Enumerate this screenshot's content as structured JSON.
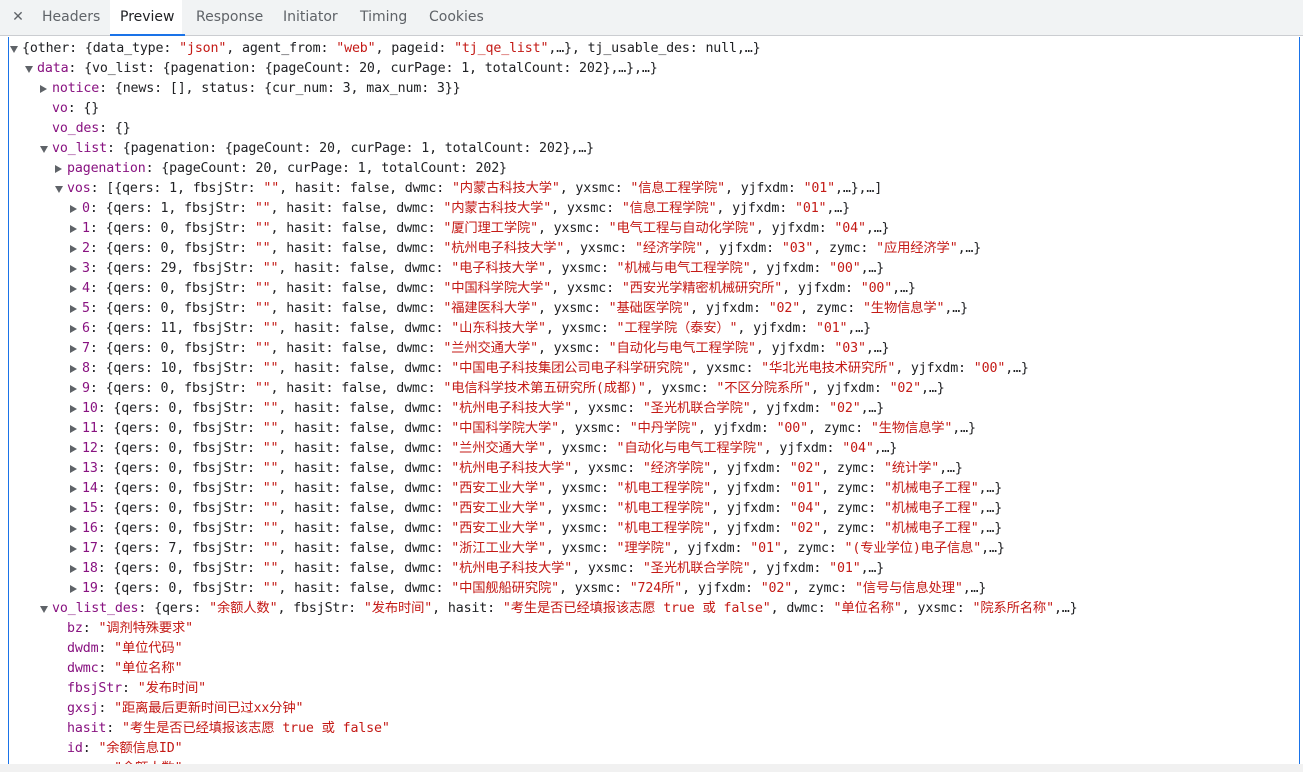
{
  "tabs": [
    {
      "label": "Headers"
    },
    {
      "label": "Preview"
    },
    {
      "label": "Response"
    },
    {
      "label": "Initiator"
    },
    {
      "label": "Timing"
    },
    {
      "label": "Cookies"
    }
  ],
  "close_glyph": "✕",
  "tree": [
    {
      "indent": 0,
      "arrow": "down",
      "segs": [
        [
          "t",
          "{other: {data_type: "
        ],
        [
          "s",
          "\"json\""
        ],
        [
          "t",
          ", agent_from: "
        ],
        [
          "s",
          "\"web\""
        ],
        [
          "t",
          ", pageid: "
        ],
        [
          "s",
          "\"tj_qe_list\""
        ],
        [
          "t",
          ",…}, tj_usable_des: null,…}"
        ]
      ]
    },
    {
      "indent": 1,
      "arrow": "down",
      "segs": [
        [
          "k",
          "data"
        ],
        [
          "t",
          ": {vo_list: {pagenation: {pageCount: 20, curPage: 1, totalCount: 202},…},…}"
        ]
      ]
    },
    {
      "indent": 2,
      "arrow": "right",
      "segs": [
        [
          "k",
          "notice"
        ],
        [
          "t",
          ": {news: [], status: {cur_num: 3, max_num: 3}}"
        ]
      ]
    },
    {
      "indent": 2,
      "arrow": "",
      "segs": [
        [
          "k",
          "vo"
        ],
        [
          "t",
          ": {}"
        ]
      ]
    },
    {
      "indent": 2,
      "arrow": "",
      "segs": [
        [
          "k",
          "vo_des"
        ],
        [
          "t",
          ": {}"
        ]
      ]
    },
    {
      "indent": 2,
      "arrow": "down",
      "segs": [
        [
          "k",
          "vo_list"
        ],
        [
          "t",
          ": {pagenation: {pageCount: 20, curPage: 1, totalCount: 202},…}"
        ]
      ]
    },
    {
      "indent": 3,
      "arrow": "right",
      "segs": [
        [
          "k",
          "pagenation"
        ],
        [
          "t",
          ": {pageCount: 20, curPage: 1, totalCount: 202}"
        ]
      ]
    },
    {
      "indent": 3,
      "arrow": "down",
      "segs": [
        [
          "k",
          "vos"
        ],
        [
          "t",
          ": [{qers: 1, fbsjStr: "
        ],
        [
          "s",
          "\"\""
        ],
        [
          "t",
          ", hasit: false, dwmc: "
        ],
        [
          "s",
          "\"内蒙古科技大学\""
        ],
        [
          "t",
          ", yxsmc: "
        ],
        [
          "s",
          "\"信息工程学院\""
        ],
        [
          "t",
          ", yjfxdm: "
        ],
        [
          "s",
          "\"01\""
        ],
        [
          "t",
          ",…},…]"
        ]
      ]
    },
    {
      "indent": 4,
      "arrow": "right",
      "segs": [
        [
          "k",
          "0"
        ],
        [
          "t",
          ": {qers: 1, fbsjStr: "
        ],
        [
          "s",
          "\"\""
        ],
        [
          "t",
          ", hasit: false, dwmc: "
        ],
        [
          "s",
          "\"内蒙古科技大学\""
        ],
        [
          "t",
          ", yxsmc: "
        ],
        [
          "s",
          "\"信息工程学院\""
        ],
        [
          "t",
          ", yjfxdm: "
        ],
        [
          "s",
          "\"01\""
        ],
        [
          "t",
          ",…}"
        ]
      ]
    },
    {
      "indent": 4,
      "arrow": "right",
      "segs": [
        [
          "k",
          "1"
        ],
        [
          "t",
          ": {qers: 0, fbsjStr: "
        ],
        [
          "s",
          "\"\""
        ],
        [
          "t",
          ", hasit: false, dwmc: "
        ],
        [
          "s",
          "\"厦门理工学院\""
        ],
        [
          "t",
          ", yxsmc: "
        ],
        [
          "s",
          "\"电气工程与自动化学院\""
        ],
        [
          "t",
          ", yjfxdm: "
        ],
        [
          "s",
          "\"04\""
        ],
        [
          "t",
          ",…}"
        ]
      ]
    },
    {
      "indent": 4,
      "arrow": "right",
      "segs": [
        [
          "k",
          "2"
        ],
        [
          "t",
          ": {qers: 0, fbsjStr: "
        ],
        [
          "s",
          "\"\""
        ],
        [
          "t",
          ", hasit: false, dwmc: "
        ],
        [
          "s",
          "\"杭州电子科技大学\""
        ],
        [
          "t",
          ", yxsmc: "
        ],
        [
          "s",
          "\"经济学院\""
        ],
        [
          "t",
          ", yjfxdm: "
        ],
        [
          "s",
          "\"03\""
        ],
        [
          "t",
          ", zymc: "
        ],
        [
          "s",
          "\"应用经济学\""
        ],
        [
          "t",
          ",…}"
        ]
      ]
    },
    {
      "indent": 4,
      "arrow": "right",
      "segs": [
        [
          "k",
          "3"
        ],
        [
          "t",
          ": {qers: 29, fbsjStr: "
        ],
        [
          "s",
          "\"\""
        ],
        [
          "t",
          ", hasit: false, dwmc: "
        ],
        [
          "s",
          "\"电子科技大学\""
        ],
        [
          "t",
          ", yxsmc: "
        ],
        [
          "s",
          "\"机械与电气工程学院\""
        ],
        [
          "t",
          ", yjfxdm: "
        ],
        [
          "s",
          "\"00\""
        ],
        [
          "t",
          ",…}"
        ]
      ]
    },
    {
      "indent": 4,
      "arrow": "right",
      "segs": [
        [
          "k",
          "4"
        ],
        [
          "t",
          ": {qers: 0, fbsjStr: "
        ],
        [
          "s",
          "\"\""
        ],
        [
          "t",
          ", hasit: false, dwmc: "
        ],
        [
          "s",
          "\"中国科学院大学\""
        ],
        [
          "t",
          ", yxsmc: "
        ],
        [
          "s",
          "\"西安光学精密机械研究所\""
        ],
        [
          "t",
          ", yjfxdm: "
        ],
        [
          "s",
          "\"00\""
        ],
        [
          "t",
          ",…}"
        ]
      ]
    },
    {
      "indent": 4,
      "arrow": "right",
      "segs": [
        [
          "k",
          "5"
        ],
        [
          "t",
          ": {qers: 0, fbsjStr: "
        ],
        [
          "s",
          "\"\""
        ],
        [
          "t",
          ", hasit: false, dwmc: "
        ],
        [
          "s",
          "\"福建医科大学\""
        ],
        [
          "t",
          ", yxsmc: "
        ],
        [
          "s",
          "\"基础医学院\""
        ],
        [
          "t",
          ", yjfxdm: "
        ],
        [
          "s",
          "\"02\""
        ],
        [
          "t",
          ", zymc: "
        ],
        [
          "s",
          "\"生物信息学\""
        ],
        [
          "t",
          ",…}"
        ]
      ]
    },
    {
      "indent": 4,
      "arrow": "right",
      "segs": [
        [
          "k",
          "6"
        ],
        [
          "t",
          ": {qers: 11, fbsjStr: "
        ],
        [
          "s",
          "\"\""
        ],
        [
          "t",
          ", hasit: false, dwmc: "
        ],
        [
          "s",
          "\"山东科技大学\""
        ],
        [
          "t",
          ", yxsmc: "
        ],
        [
          "s",
          "\"工程学院（泰安）\""
        ],
        [
          "t",
          ", yjfxdm: "
        ],
        [
          "s",
          "\"01\""
        ],
        [
          "t",
          ",…}"
        ]
      ]
    },
    {
      "indent": 4,
      "arrow": "right",
      "segs": [
        [
          "k",
          "7"
        ],
        [
          "t",
          ": {qers: 0, fbsjStr: "
        ],
        [
          "s",
          "\"\""
        ],
        [
          "t",
          ", hasit: false, dwmc: "
        ],
        [
          "s",
          "\"兰州交通大学\""
        ],
        [
          "t",
          ", yxsmc: "
        ],
        [
          "s",
          "\"自动化与电气工程学院\""
        ],
        [
          "t",
          ", yjfxdm: "
        ],
        [
          "s",
          "\"03\""
        ],
        [
          "t",
          ",…}"
        ]
      ]
    },
    {
      "indent": 4,
      "arrow": "right",
      "segs": [
        [
          "k",
          "8"
        ],
        [
          "t",
          ": {qers: 10, fbsjStr: "
        ],
        [
          "s",
          "\"\""
        ],
        [
          "t",
          ", hasit: false, dwmc: "
        ],
        [
          "s",
          "\"中国电子科技集团公司电子科学研究院\""
        ],
        [
          "t",
          ", yxsmc: "
        ],
        [
          "s",
          "\"华北光电技术研究所\""
        ],
        [
          "t",
          ", yjfxdm: "
        ],
        [
          "s",
          "\"00\""
        ],
        [
          "t",
          ",…}"
        ]
      ]
    },
    {
      "indent": 4,
      "arrow": "right",
      "segs": [
        [
          "k",
          "9"
        ],
        [
          "t",
          ": {qers: 0, fbsjStr: "
        ],
        [
          "s",
          "\"\""
        ],
        [
          "t",
          ", hasit: false, dwmc: "
        ],
        [
          "s",
          "\"电信科学技术第五研究所(成都)\""
        ],
        [
          "t",
          ", yxsmc: "
        ],
        [
          "s",
          "\"不区分院系所\""
        ],
        [
          "t",
          ", yjfxdm: "
        ],
        [
          "s",
          "\"02\""
        ],
        [
          "t",
          ",…}"
        ]
      ]
    },
    {
      "indent": 4,
      "arrow": "right",
      "segs": [
        [
          "k",
          "10"
        ],
        [
          "t",
          ": {qers: 0, fbsjStr: "
        ],
        [
          "s",
          "\"\""
        ],
        [
          "t",
          ", hasit: false, dwmc: "
        ],
        [
          "s",
          "\"杭州电子科技大学\""
        ],
        [
          "t",
          ", yxsmc: "
        ],
        [
          "s",
          "\"圣光机联合学院\""
        ],
        [
          "t",
          ", yjfxdm: "
        ],
        [
          "s",
          "\"02\""
        ],
        [
          "t",
          ",…}"
        ]
      ]
    },
    {
      "indent": 4,
      "arrow": "right",
      "segs": [
        [
          "k",
          "11"
        ],
        [
          "t",
          ": {qers: 0, fbsjStr: "
        ],
        [
          "s",
          "\"\""
        ],
        [
          "t",
          ", hasit: false, dwmc: "
        ],
        [
          "s",
          "\"中国科学院大学\""
        ],
        [
          "t",
          ", yxsmc: "
        ],
        [
          "s",
          "\"中丹学院\""
        ],
        [
          "t",
          ", yjfxdm: "
        ],
        [
          "s",
          "\"00\""
        ],
        [
          "t",
          ", zymc: "
        ],
        [
          "s",
          "\"生物信息学\""
        ],
        [
          "t",
          ",…}"
        ]
      ]
    },
    {
      "indent": 4,
      "arrow": "right",
      "segs": [
        [
          "k",
          "12"
        ],
        [
          "t",
          ": {qers: 0, fbsjStr: "
        ],
        [
          "s",
          "\"\""
        ],
        [
          "t",
          ", hasit: false, dwmc: "
        ],
        [
          "s",
          "\"兰州交通大学\""
        ],
        [
          "t",
          ", yxsmc: "
        ],
        [
          "s",
          "\"自动化与电气工程学院\""
        ],
        [
          "t",
          ", yjfxdm: "
        ],
        [
          "s",
          "\"04\""
        ],
        [
          "t",
          ",…}"
        ]
      ]
    },
    {
      "indent": 4,
      "arrow": "right",
      "segs": [
        [
          "k",
          "13"
        ],
        [
          "t",
          ": {qers: 0, fbsjStr: "
        ],
        [
          "s",
          "\"\""
        ],
        [
          "t",
          ", hasit: false, dwmc: "
        ],
        [
          "s",
          "\"杭州电子科技大学\""
        ],
        [
          "t",
          ", yxsmc: "
        ],
        [
          "s",
          "\"经济学院\""
        ],
        [
          "t",
          ", yjfxdm: "
        ],
        [
          "s",
          "\"02\""
        ],
        [
          "t",
          ", zymc: "
        ],
        [
          "s",
          "\"统计学\""
        ],
        [
          "t",
          ",…}"
        ]
      ]
    },
    {
      "indent": 4,
      "arrow": "right",
      "segs": [
        [
          "k",
          "14"
        ],
        [
          "t",
          ": {qers: 0, fbsjStr: "
        ],
        [
          "s",
          "\"\""
        ],
        [
          "t",
          ", hasit: false, dwmc: "
        ],
        [
          "s",
          "\"西安工业大学\""
        ],
        [
          "t",
          ", yxsmc: "
        ],
        [
          "s",
          "\"机电工程学院\""
        ],
        [
          "t",
          ", yjfxdm: "
        ],
        [
          "s",
          "\"01\""
        ],
        [
          "t",
          ", zymc: "
        ],
        [
          "s",
          "\"机械电子工程\""
        ],
        [
          "t",
          ",…}"
        ]
      ]
    },
    {
      "indent": 4,
      "arrow": "right",
      "segs": [
        [
          "k",
          "15"
        ],
        [
          "t",
          ": {qers: 0, fbsjStr: "
        ],
        [
          "s",
          "\"\""
        ],
        [
          "t",
          ", hasit: false, dwmc: "
        ],
        [
          "s",
          "\"西安工业大学\""
        ],
        [
          "t",
          ", yxsmc: "
        ],
        [
          "s",
          "\"机电工程学院\""
        ],
        [
          "t",
          ", yjfxdm: "
        ],
        [
          "s",
          "\"04\""
        ],
        [
          "t",
          ", zymc: "
        ],
        [
          "s",
          "\"机械电子工程\""
        ],
        [
          "t",
          ",…}"
        ]
      ]
    },
    {
      "indent": 4,
      "arrow": "right",
      "segs": [
        [
          "k",
          "16"
        ],
        [
          "t",
          ": {qers: 0, fbsjStr: "
        ],
        [
          "s",
          "\"\""
        ],
        [
          "t",
          ", hasit: false, dwmc: "
        ],
        [
          "s",
          "\"西安工业大学\""
        ],
        [
          "t",
          ", yxsmc: "
        ],
        [
          "s",
          "\"机电工程学院\""
        ],
        [
          "t",
          ", yjfxdm: "
        ],
        [
          "s",
          "\"02\""
        ],
        [
          "t",
          ", zymc: "
        ],
        [
          "s",
          "\"机械电子工程\""
        ],
        [
          "t",
          ",…}"
        ]
      ]
    },
    {
      "indent": 4,
      "arrow": "right",
      "segs": [
        [
          "k",
          "17"
        ],
        [
          "t",
          ": {qers: 7, fbsjStr: "
        ],
        [
          "s",
          "\"\""
        ],
        [
          "t",
          ", hasit: false, dwmc: "
        ],
        [
          "s",
          "\"浙江工业大学\""
        ],
        [
          "t",
          ", yxsmc: "
        ],
        [
          "s",
          "\"理学院\""
        ],
        [
          "t",
          ", yjfxdm: "
        ],
        [
          "s",
          "\"01\""
        ],
        [
          "t",
          ", zymc: "
        ],
        [
          "s",
          "\"(专业学位)电子信息\""
        ],
        [
          "t",
          ",…}"
        ]
      ]
    },
    {
      "indent": 4,
      "arrow": "right",
      "segs": [
        [
          "k",
          "18"
        ],
        [
          "t",
          ": {qers: 0, fbsjStr: "
        ],
        [
          "s",
          "\"\""
        ],
        [
          "t",
          ", hasit: false, dwmc: "
        ],
        [
          "s",
          "\"杭州电子科技大学\""
        ],
        [
          "t",
          ", yxsmc: "
        ],
        [
          "s",
          "\"圣光机联合学院\""
        ],
        [
          "t",
          ", yjfxdm: "
        ],
        [
          "s",
          "\"01\""
        ],
        [
          "t",
          ",…}"
        ]
      ]
    },
    {
      "indent": 4,
      "arrow": "right",
      "segs": [
        [
          "k",
          "19"
        ],
        [
          "t",
          ": {qers: 0, fbsjStr: "
        ],
        [
          "s",
          "\"\""
        ],
        [
          "t",
          ", hasit: false, dwmc: "
        ],
        [
          "s",
          "\"中国舰船研究院\""
        ],
        [
          "t",
          ", yxsmc: "
        ],
        [
          "s",
          "\"724所\""
        ],
        [
          "t",
          ", yjfxdm: "
        ],
        [
          "s",
          "\"02\""
        ],
        [
          "t",
          ", zymc: "
        ],
        [
          "s",
          "\"信号与信息处理\""
        ],
        [
          "t",
          ",…}"
        ]
      ]
    },
    {
      "indent": 2,
      "arrow": "down",
      "segs": [
        [
          "k",
          "vo_list_des"
        ],
        [
          "t",
          ": {qers: "
        ],
        [
          "s",
          "\"余额人数\""
        ],
        [
          "t",
          ", fbsjStr: "
        ],
        [
          "s",
          "\"发布时间\""
        ],
        [
          "t",
          ", hasit: "
        ],
        [
          "s",
          "\"考生是否已经填报该志愿 true 或 false\""
        ],
        [
          "t",
          ", dwmc: "
        ],
        [
          "s",
          "\"单位名称\""
        ],
        [
          "t",
          ", yxsmc: "
        ],
        [
          "s",
          "\"院系所名称\""
        ],
        [
          "t",
          ",…}"
        ]
      ]
    },
    {
      "indent": 3,
      "arrow": "",
      "segs": [
        [
          "k",
          "bz"
        ],
        [
          "t",
          ": "
        ],
        [
          "s",
          "\"调剂特殊要求\""
        ]
      ]
    },
    {
      "indent": 3,
      "arrow": "",
      "segs": [
        [
          "k",
          "dwdm"
        ],
        [
          "t",
          ": "
        ],
        [
          "s",
          "\"单位代码\""
        ]
      ]
    },
    {
      "indent": 3,
      "arrow": "",
      "segs": [
        [
          "k",
          "dwmc"
        ],
        [
          "t",
          ": "
        ],
        [
          "s",
          "\"单位名称\""
        ]
      ]
    },
    {
      "indent": 3,
      "arrow": "",
      "segs": [
        [
          "k",
          "fbsjStr"
        ],
        [
          "t",
          ": "
        ],
        [
          "s",
          "\"发布时间\""
        ]
      ]
    },
    {
      "indent": 3,
      "arrow": "",
      "segs": [
        [
          "k",
          "gxsj"
        ],
        [
          "t",
          ": "
        ],
        [
          "s",
          "\"距离最后更新时间已过xx分钟\""
        ]
      ]
    },
    {
      "indent": 3,
      "arrow": "",
      "segs": [
        [
          "k",
          "hasit"
        ],
        [
          "t",
          ": "
        ],
        [
          "s",
          "\"考生是否已经填报该志愿 true 或 false\""
        ]
      ]
    },
    {
      "indent": 3,
      "arrow": "",
      "segs": [
        [
          "k",
          "id"
        ],
        [
          "t",
          ": "
        ],
        [
          "s",
          "\"余额信息ID\""
        ]
      ]
    },
    {
      "indent": 3,
      "arrow": "",
      "segs": [
        [
          "k",
          "qers"
        ],
        [
          "t",
          ": "
        ],
        [
          "s",
          "\"余额人数\""
        ]
      ]
    }
  ]
}
